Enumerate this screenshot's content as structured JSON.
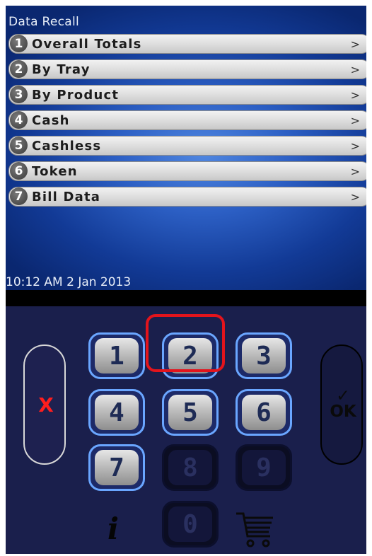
{
  "screen": {
    "title": "Data Recall",
    "datetime": "10:12 AM 2 Jan 2013"
  },
  "menu": [
    {
      "num": "1",
      "label": "Overall Totals",
      "arrow": ">"
    },
    {
      "num": "2",
      "label": "By Tray",
      "arrow": ">"
    },
    {
      "num": "3",
      "label": "By Product",
      "arrow": ">"
    },
    {
      "num": "4",
      "label": "Cash",
      "arrow": ">"
    },
    {
      "num": "5",
      "label": "Cashless",
      "arrow": ">"
    },
    {
      "num": "6",
      "label": "Token",
      "arrow": ">"
    },
    {
      "num": "7",
      "label": "Bill Data",
      "arrow": ">"
    }
  ],
  "keypad": {
    "keys": [
      "1",
      "2",
      "3",
      "4",
      "5",
      "6",
      "7",
      "8",
      "9",
      "0"
    ],
    "enabled": [
      true,
      true,
      true,
      true,
      true,
      true,
      true,
      false,
      false,
      false
    ],
    "highlighted_key": "2",
    "cancel_label": "X",
    "ok_label": "OK",
    "ok_check": "✓",
    "info_label": "i"
  },
  "colors": {
    "screen_blue": "#2c5fc4",
    "keypad_bg": "#1a1f4c",
    "highlight": "#e3141c",
    "cancel_x": "#ff1e1e",
    "key_border": "#6aa6ff"
  }
}
